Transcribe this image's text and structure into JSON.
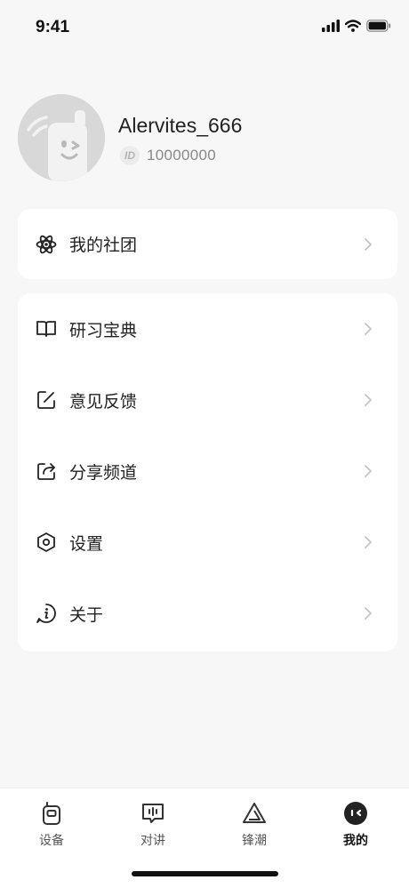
{
  "status_bar": {
    "time": "9:41"
  },
  "profile": {
    "username": "Alervites_666",
    "id_badge": "ID",
    "id_value": "10000000"
  },
  "club_card": {
    "label": "我的社团",
    "icon": "atom-icon"
  },
  "menu": {
    "items": [
      {
        "label": "研习宝典",
        "icon": "book-icon"
      },
      {
        "label": "意见反馈",
        "icon": "edit-square-icon"
      },
      {
        "label": "分享频道",
        "icon": "share-icon"
      },
      {
        "label": "设置",
        "icon": "hexagon-settings-icon"
      },
      {
        "label": "关于",
        "icon": "info-icon"
      }
    ]
  },
  "tabbar": {
    "tabs": [
      {
        "label": "设备",
        "icon": "walkie-talkie-icon",
        "active": false
      },
      {
        "label": "对讲",
        "icon": "chat-icon",
        "active": false
      },
      {
        "label": "锋潮",
        "icon": "triangle-logo-icon",
        "active": false
      },
      {
        "label": "我的",
        "icon": "face-icon",
        "active": true
      }
    ]
  },
  "colors": {
    "background": "#f7f7f7",
    "card": "#ffffff",
    "text": "#222222",
    "muted": "#888888",
    "chevron": "#c4c4c4",
    "avatar": "#d9d9d9"
  }
}
